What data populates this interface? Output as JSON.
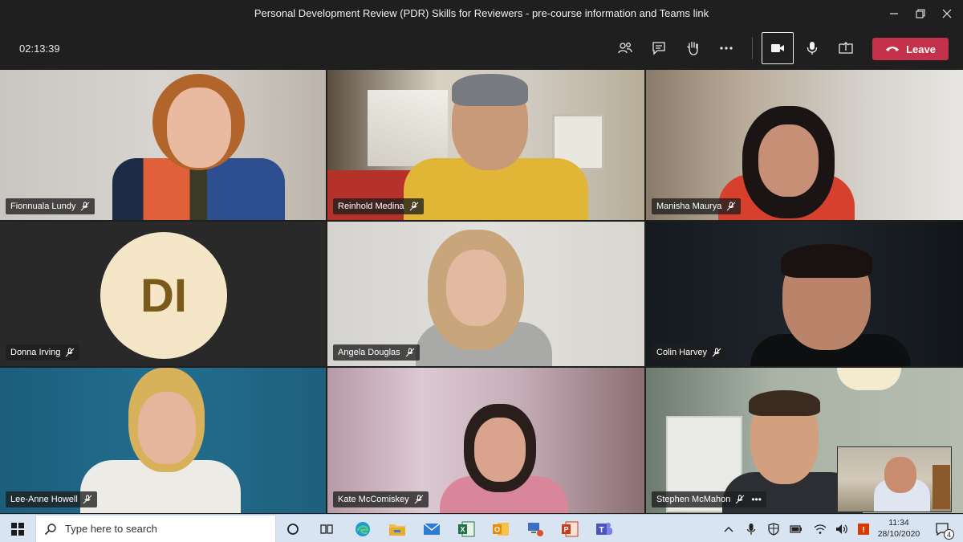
{
  "window": {
    "title": "Personal Development Review (PDR) Skills for Reviewers - pre-course information and Teams link"
  },
  "meeting": {
    "timer": "02:13:39",
    "leave_label": "Leave"
  },
  "participants": [
    {
      "name": "Fionnuala Lundy"
    },
    {
      "name": "Reinhold Medina"
    },
    {
      "name": "Manisha Maurya"
    },
    {
      "name": "Donna Irving",
      "initials": "DI"
    },
    {
      "name": "Angela Douglas"
    },
    {
      "name": "Colin Harvey"
    },
    {
      "name": "Lee-Anne Howell"
    },
    {
      "name": "Kate McComiskey"
    },
    {
      "name": "Stephen McMahon"
    }
  ],
  "taskbar": {
    "search_placeholder": "Type here to search",
    "clock_time": "11:34",
    "clock_date": "28/10/2020",
    "notification_count": "4"
  },
  "colors": {
    "leave": "#c4314b",
    "avatar_bg": "#f5e6c8",
    "avatar_text": "#7a5a1a"
  }
}
